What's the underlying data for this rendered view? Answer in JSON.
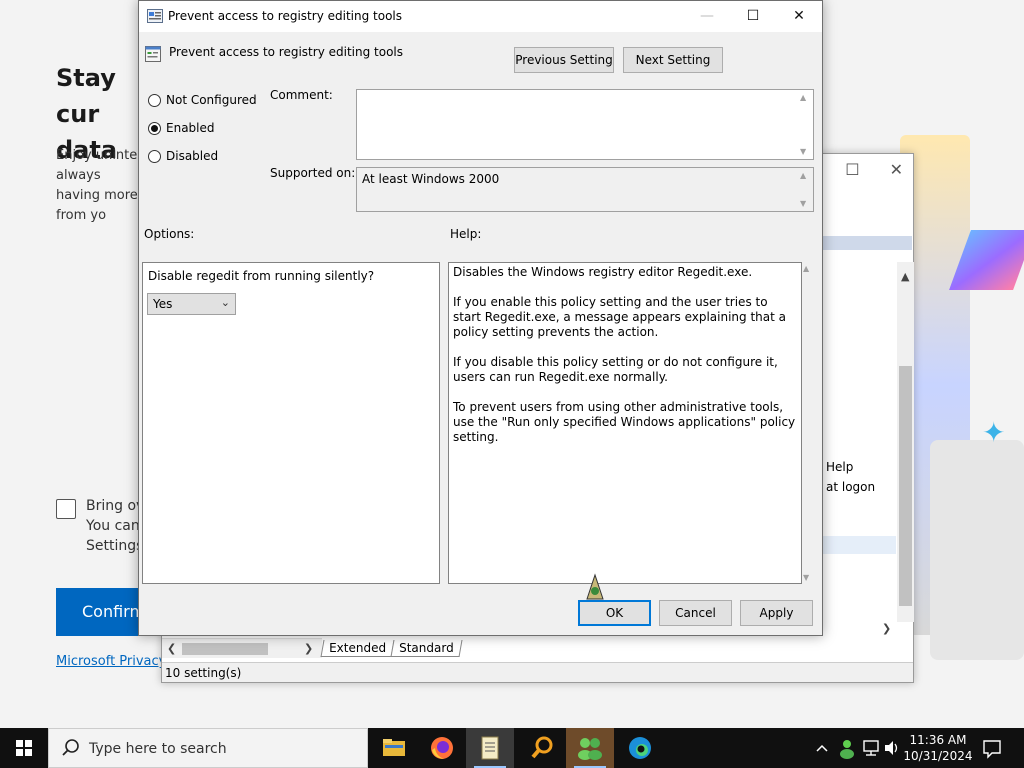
{
  "background_page": {
    "title": "Stay cur data",
    "body": "Enjoy uninter always having more from yo",
    "checkbox_text": "Bring ov You can Settings.",
    "confirm_label": "Confirm",
    "privacy_link": "Microsoft Privacy"
  },
  "behind_window": {
    "text_help": "Help",
    "text_logon": "at logon",
    "text_partial": "only specified Windows",
    "tabs": [
      "Extended",
      "Standard"
    ],
    "status": "10 setting(s)"
  },
  "dialog": {
    "window_title": "Prevent access to registry editing tools",
    "header_title": "Prevent access to registry editing tools",
    "prev_button": "Previous Setting",
    "next_button": "Next Setting",
    "radios": [
      {
        "label": "Not Configured",
        "checked": false
      },
      {
        "label": "Enabled",
        "checked": true
      },
      {
        "label": "Disabled",
        "checked": false
      }
    ],
    "comment_label": "Comment:",
    "comment_value": "",
    "supported_label": "Supported on:",
    "supported_value": "At least Windows 2000",
    "options_label": "Options:",
    "help_label": "Help:",
    "option_question": "Disable regedit from running silently?",
    "option_selected": "Yes",
    "help_paragraphs": [
      "Disables the Windows registry editor Regedit.exe.",
      "If you enable this policy setting and the user tries to start Regedit.exe, a message appears explaining that a policy setting prevents the action.",
      "If you disable this policy setting or do not configure it, users can run Regedit.exe normally.",
      "To prevent users from using other administrative tools, use the \"Run only specified Windows applications\" policy setting."
    ],
    "ok_label": "OK",
    "cancel_label": "Cancel",
    "apply_label": "Apply"
  },
  "taskbar": {
    "search_placeholder": "Type here to search",
    "apps": [
      "file-explorer-icon",
      "firefox-icon",
      "notepad-icon",
      "search-app-icon",
      "group-policy-icon",
      "edge-icon"
    ],
    "time": "11:36 AM",
    "date": "10/31/2024"
  },
  "colors": {
    "accent": "#0078d7",
    "edge_blue": "#0067c0",
    "taskbar": "#101010"
  }
}
